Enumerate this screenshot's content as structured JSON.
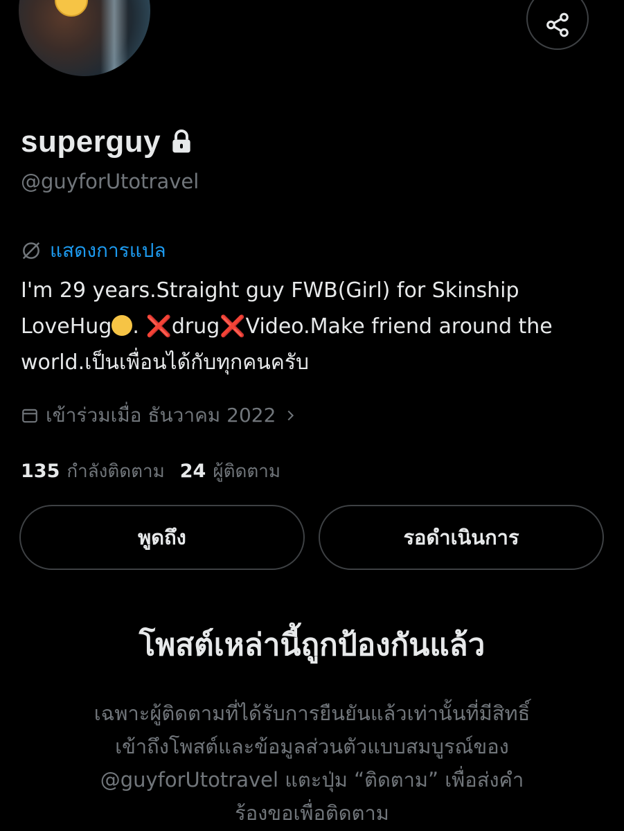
{
  "profile": {
    "display_name": "superguy",
    "handle": "@guyforUtotravel",
    "translate_label": "แสดงการแปล",
    "bio": {
      "line1": "I'm 29 years.Straight guy FWB(Girl) for Skinship",
      "line2_a": "LoveHug",
      "line2_b": ". ",
      "line2_x1": "❌",
      "line2_c": "drug",
      "line2_x2": "❌",
      "line2_d": "Video.Make friend around the",
      "line3": "world.เป็นเพื่อนได้กับทุกคนครับ"
    },
    "joined": "เข้าร่วมเมื่อ ธันวาคม 2022",
    "following_count": "135",
    "following_label": "กำลังติดตาม",
    "followers_count": "24",
    "followers_label": "ผู้ติดตาม"
  },
  "actions": {
    "mention_label": "พูดถึง",
    "pending_label": "รอดำเนินการ"
  },
  "protected": {
    "title": "โพสต์เหล่านี้ถูกป้องกันแล้ว",
    "line1": "เฉพาะผู้ติดตามที่ได้รับการยืนยันแล้วเท่านั้นที่มีสิทธิ์",
    "line2": "เข้าถึงโพสต์และข้อมูลส่วนตัวแบบสมบูรณ์ของ",
    "line3": "@guyforUtotravel แตะปุ่ม “ติดตาม” เพื่อส่งคำ",
    "line4": "ร้องขอเพื่อติดตาม"
  },
  "icons": {
    "share": "share-icon",
    "lock": "lock-icon",
    "translate": "translate-icon",
    "calendar": "calendar-icon",
    "chevron": "chevron-right-icon"
  },
  "colors": {
    "background": "#000000",
    "text": "#e7e9ea",
    "muted": "#71767b",
    "link": "#1d9bf0",
    "border": "#3e4144"
  }
}
